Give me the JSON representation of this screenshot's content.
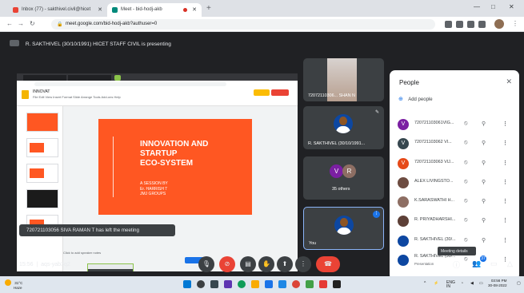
{
  "browser": {
    "tabs": [
      {
        "label": "Inbox (77) - sakthivel.civil@hicet"
      },
      {
        "label": "Meet - bid-hodj-akb"
      }
    ],
    "url": "meet.google.com/bid-hodj-akb?authuser=0"
  },
  "meet": {
    "presenting_banner": "R. SAKTHIVEL (30/10/1991) HICET STAFF CIVIL is presenting",
    "slide": {
      "title": "INNOVATION AND\nSTARTUP\nECO-SYSTEM",
      "subtitle": "A SESSION BY\nEr. HARRISH T\nJMJ GROUPS"
    },
    "shared_window": {
      "doc_title": "INNOVAT",
      "menus": "File  Edit  View  Insert  Format  Slide  Arrange  Tools  Add-ons  Help",
      "speaker_notes": "Click to add speaker notes"
    },
    "toast": "720721103056 SIVA RAMAN T has left the meeting",
    "tiles": [
      {
        "name": "72072110306... SHAN N"
      },
      {
        "name": "R. SAKTHIVEL (30/10/1991..."
      },
      {
        "name": "35 others",
        "initials": [
          "V",
          "R"
        ]
      },
      {
        "name": "You"
      }
    ],
    "meeting_code": "aqs-yab3q2",
    "clock": "15:56"
  },
  "people_panel": {
    "title": "People",
    "add_people": "Add people",
    "participants": [
      {
        "name": "720721103061VIG...",
        "avatar": "V",
        "color": "#7b1fa2"
      },
      {
        "name": "720721103062 VI...",
        "avatar": "V",
        "color": "#37474f"
      },
      {
        "name": "720721103063 VIJ...",
        "avatar": "V",
        "color": "#e64a19"
      },
      {
        "name": "ALEX LIVINGSTO...",
        "avatar": "",
        "color": "#6d4c41"
      },
      {
        "name": "K.SARASWATHI H...",
        "avatar": "",
        "color": "#8d6e63"
      },
      {
        "name": "R. PRIYADHARSHI...",
        "avatar": "",
        "color": "#5d4037"
      },
      {
        "name": "R. SAKTHIVEL (30/...",
        "avatar": "",
        "color": "#0d47a1"
      },
      {
        "name": "R. SAKTHIVEL (30/...",
        "avatar": "",
        "color": "#0d47a1",
        "sub": "Presentation"
      }
    ],
    "tooltip": "Meeting details",
    "people_count": "37"
  },
  "taskbar": {
    "weather_temp": "31°C",
    "weather_desc": "Haze",
    "time": "03:56 PM",
    "date": "30-08-2022",
    "lang": "ENG\nIN"
  }
}
